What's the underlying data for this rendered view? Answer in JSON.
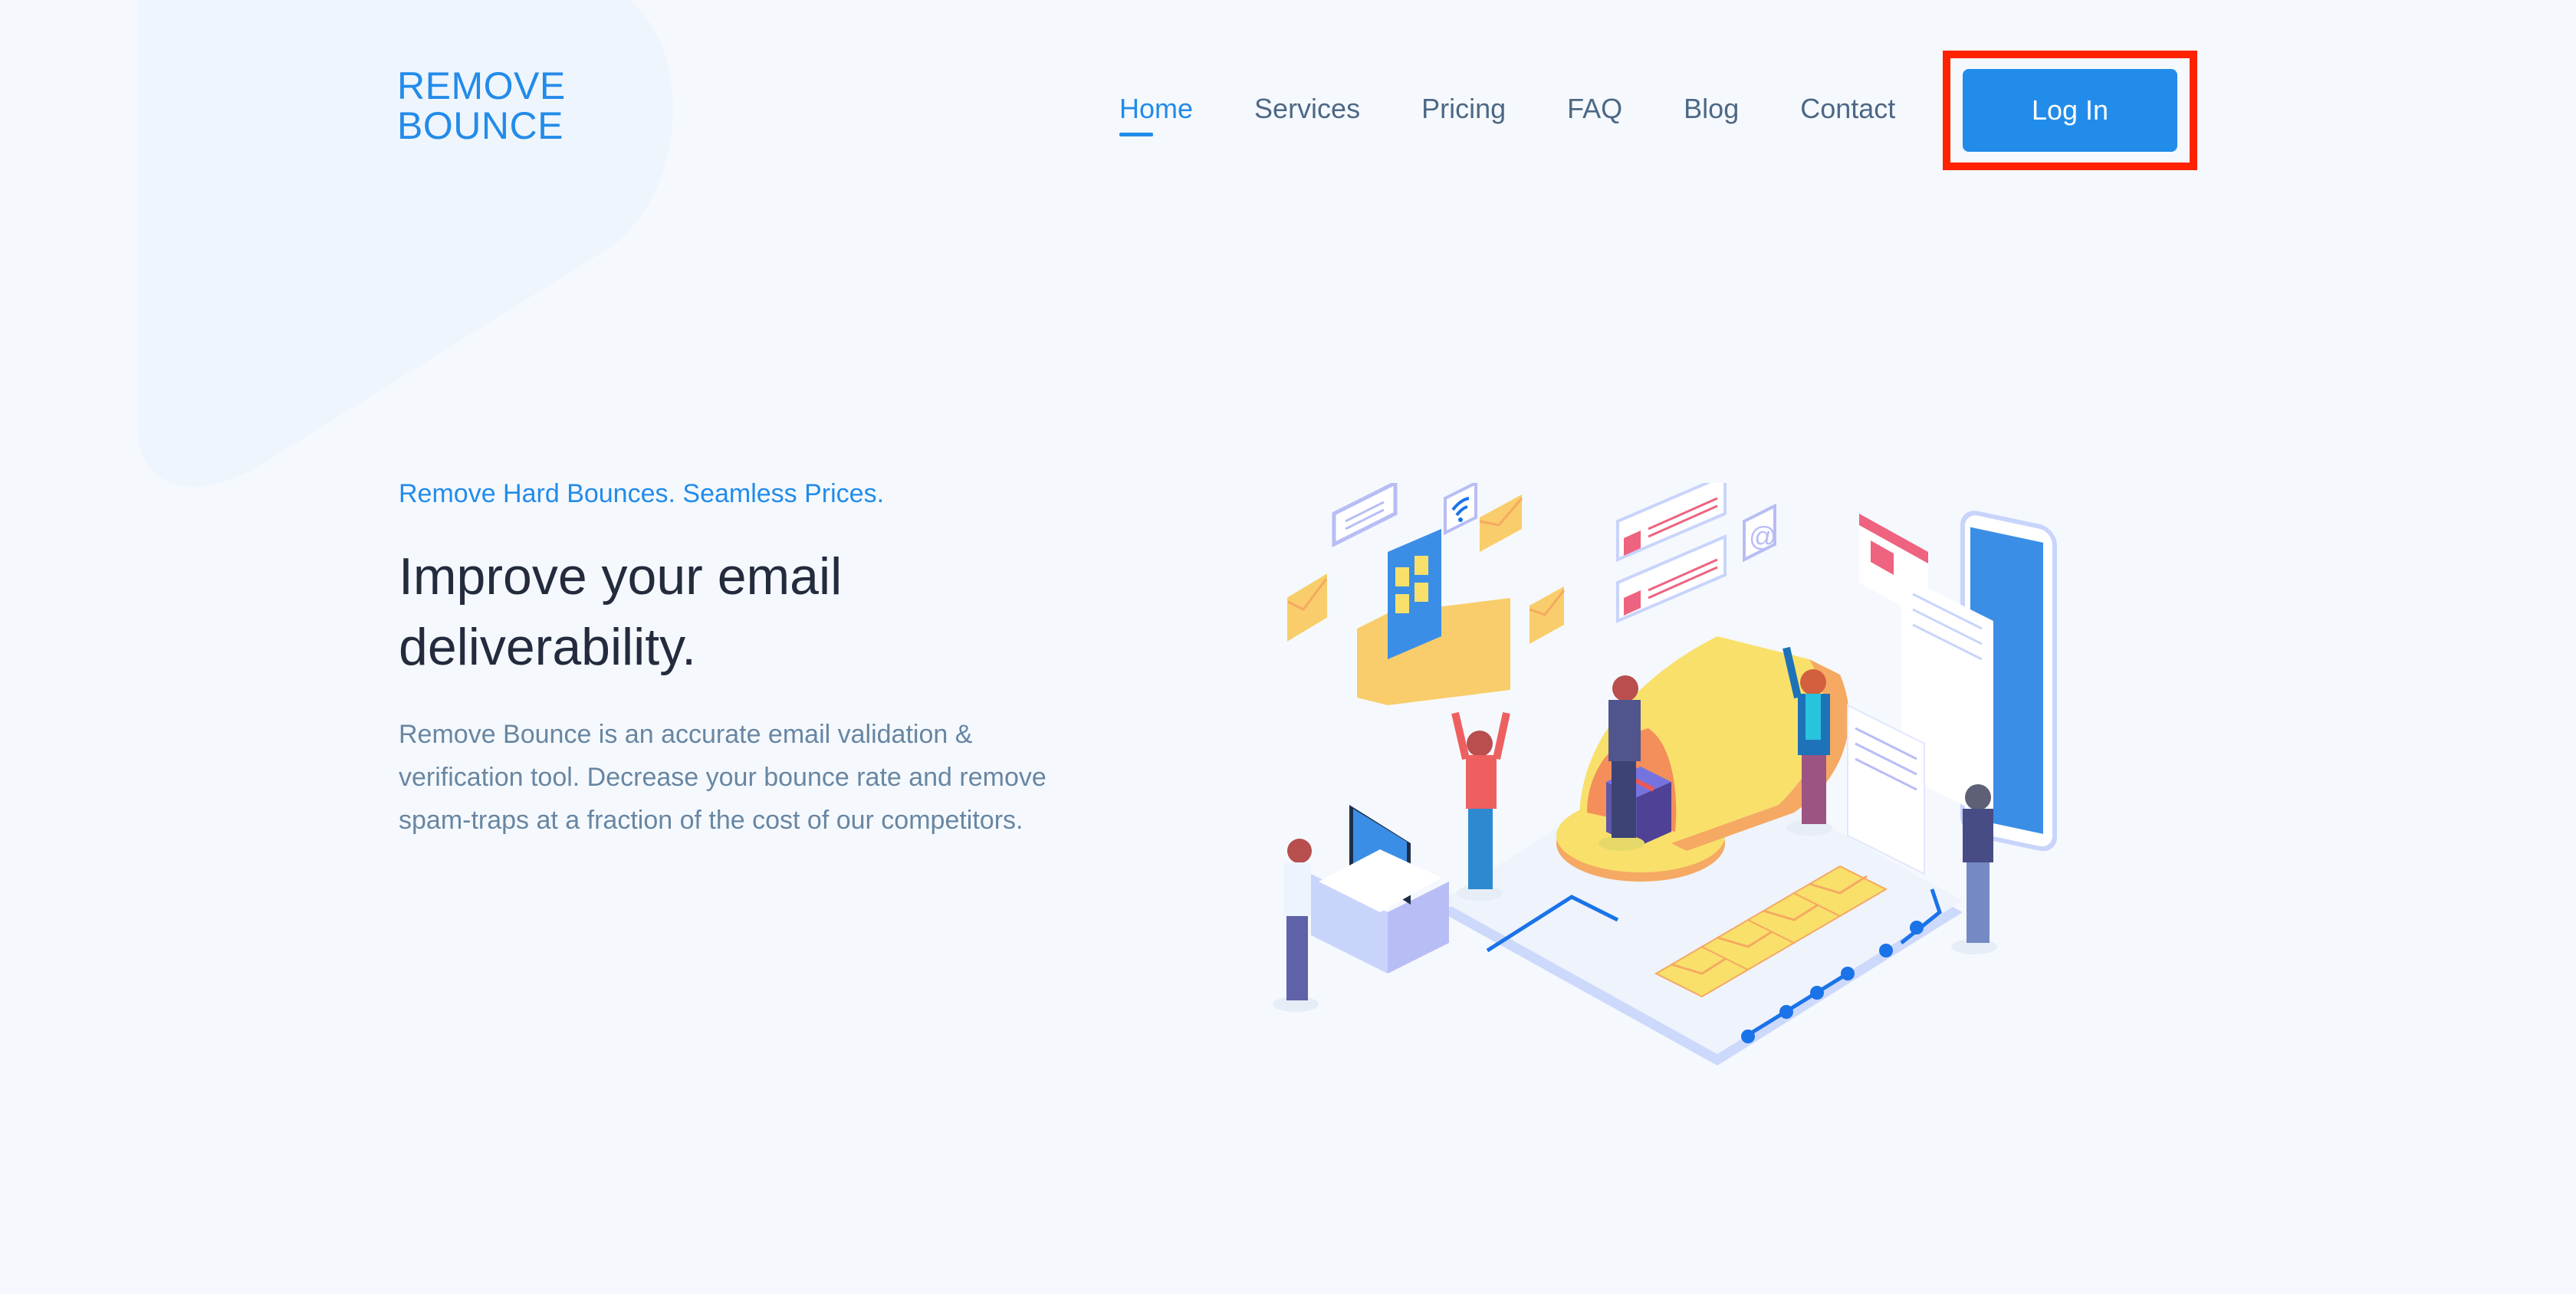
{
  "brand": {
    "line1": "REMOVE",
    "line2": "BOUNCE",
    "color": "#238be9"
  },
  "nav": {
    "items": [
      {
        "label": "Home",
        "active": true
      },
      {
        "label": "Services",
        "active": false
      },
      {
        "label": "Pricing",
        "active": false
      },
      {
        "label": "FAQ",
        "active": false
      },
      {
        "label": "Blog",
        "active": false
      },
      {
        "label": "Contact",
        "active": false
      }
    ],
    "login_label": "Log In"
  },
  "hero": {
    "tagline": "Remove Hard Bounces. Seamless Prices.",
    "headline_line1": "Improve your email",
    "headline_line2": "deliverability.",
    "description": "Remove Bounce is an accurate email validation & verification tool. Decrease your bounce rate and remove spam-traps at a fraction of the cost of our competitors."
  },
  "illustration": {
    "subject": "isometric email delivery scene with people, mailbox, envelopes, phone and documents",
    "icons": [
      "envelope-icon",
      "wifi-icon",
      "at-sign-icon",
      "chat-bubble-icon",
      "laptop-icon",
      "phone-icon",
      "gift-box-icon",
      "document-icon",
      "browser-window-icon"
    ]
  },
  "colors": {
    "background": "#f5f9fe",
    "accent": "#238be9",
    "button": "#228ceb",
    "heading": "#232b3d",
    "body_text": "#6886a2",
    "nav_text": "#4d6885",
    "highlight": "#ff2200"
  }
}
